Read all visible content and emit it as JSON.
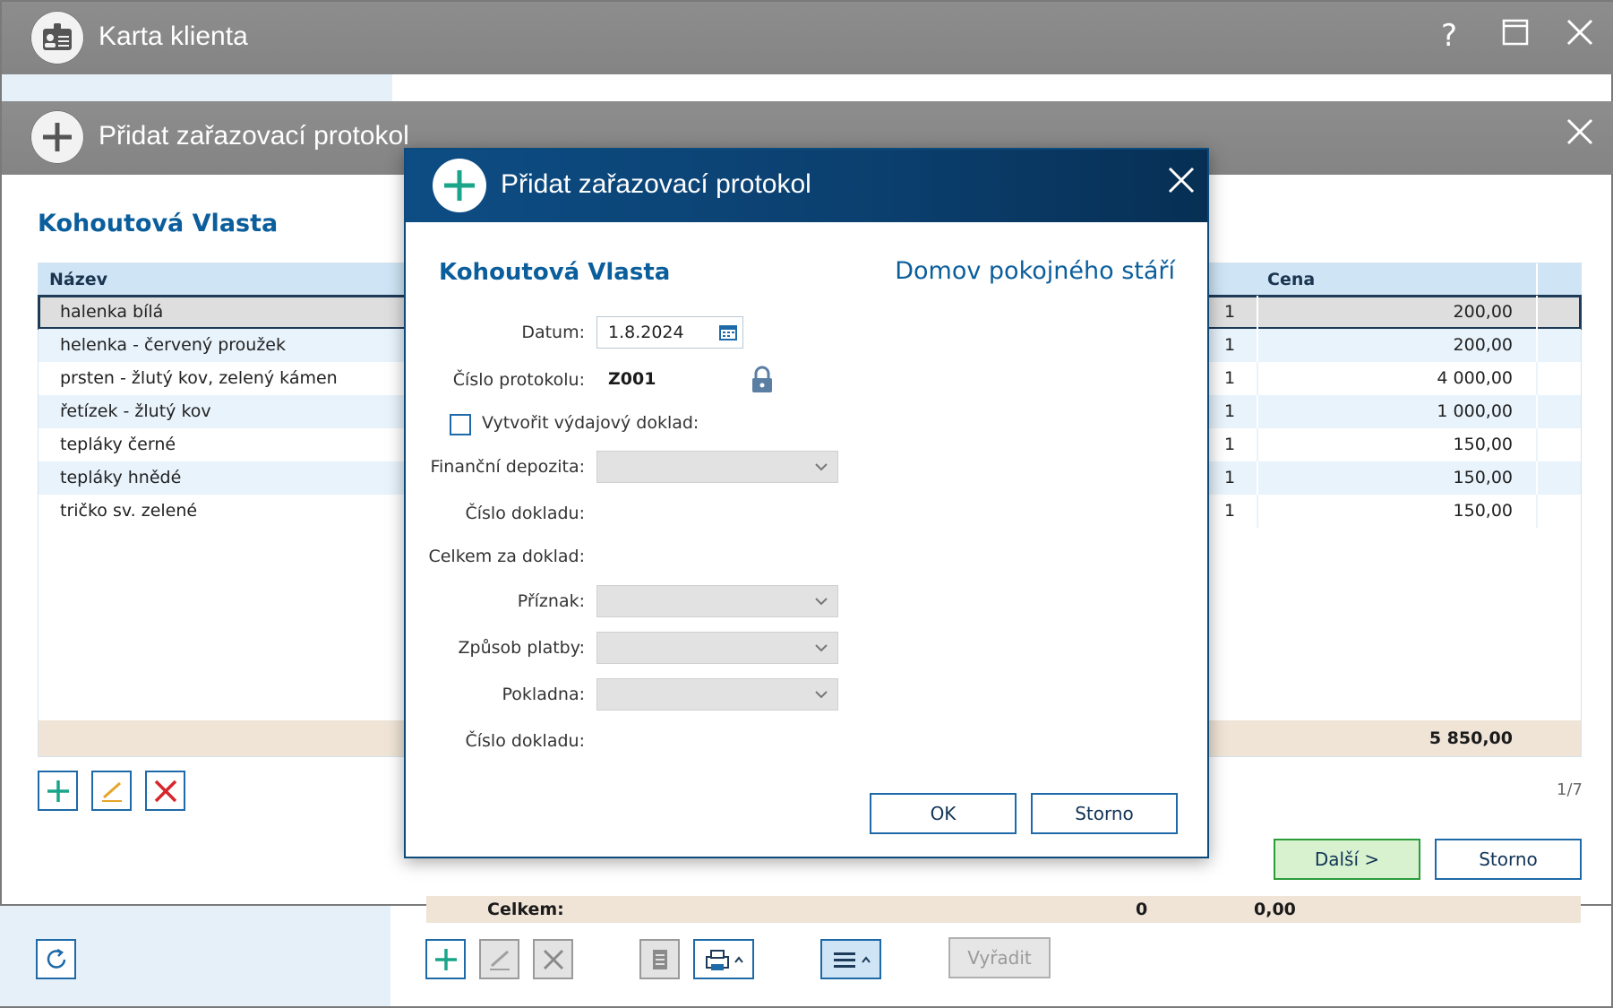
{
  "outer_window": {
    "title": "Karta klienta",
    "help_label": "?"
  },
  "layer2": {
    "title": "Přidat zařazovací protokol",
    "client_name": "Kohoutová Vlasta",
    "grid": {
      "columns": [
        "Název",
        "Cena"
      ],
      "rows": [
        {
          "name": "halenka bílá",
          "qty": "1",
          "price": "200,00"
        },
        {
          "name": "helenka - červený proužek",
          "qty": "1",
          "price": "200,00"
        },
        {
          "name": "prsten - žlutý kov, zelený kámen",
          "qty": "1",
          "price": "4 000,00"
        },
        {
          "name": "řetízek - žlutý kov",
          "qty": "1",
          "price": "1 000,00"
        },
        {
          "name": "tepláky černé",
          "qty": "1",
          "price": "150,00"
        },
        {
          "name": "tepláky hnědé",
          "qty": "1",
          "price": "150,00"
        },
        {
          "name": "tričko sv. zelené",
          "qty": "1",
          "price": "150,00"
        }
      ],
      "total": "5 850,00",
      "page_indicator": "1/7"
    },
    "next_button": "Další >",
    "cancel_button": "Storno"
  },
  "background_bottom": {
    "total_label": "Celkem:",
    "total_qty": "0",
    "total_price": "0,00",
    "remove_button": "Vyřadit"
  },
  "modal": {
    "title": "Přidat zařazovací protokol",
    "client_name": "Kohoutová Vlasta",
    "facility": "Domov pokojného stáří",
    "fields": {
      "date_label": "Datum:",
      "date_value": "1.8.2024",
      "protocol_label": "Číslo protokolu:",
      "protocol_value": "Z001",
      "create_doc_label": "Vytvořit výdajový doklad:",
      "deposit_label": "Finanční depozita:",
      "doc_number_label": "Číslo dokladu:",
      "doc_total_label": "Celkem za doklad:",
      "flag_label": "Příznak:",
      "payment_label": "Způsob platby:",
      "cashbox_label": "Pokladna:",
      "doc_number2_label": "Číslo dokladu:"
    },
    "ok_button": "OK",
    "cancel_button": "Storno"
  },
  "colors": {
    "accent_blue": "#0b5e9c",
    "modal_title_bg": "#0b3f6e",
    "plus_green": "#1aa58a",
    "delete_red": "#d6262b",
    "edit_orange": "#e6a52a"
  }
}
